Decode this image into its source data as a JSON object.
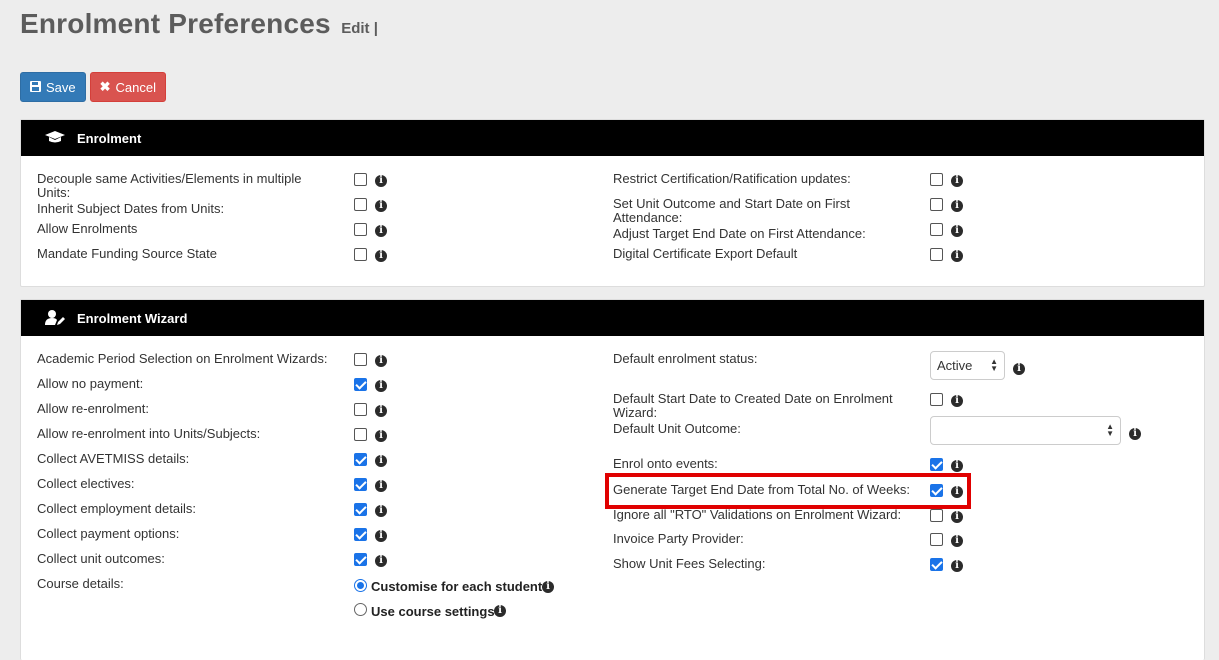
{
  "header": {
    "title": "Enrolment Preferences",
    "subtitle": "Edit |"
  },
  "toolbar": {
    "save_label": "Save",
    "cancel_label": "Cancel",
    "save_icon": "floppy-icon",
    "cancel_icon": "x-icon"
  },
  "enrolment": {
    "title": "Enrolment",
    "icon": "graduation-cap-icon",
    "left": [
      {
        "label_line1": "Decouple same Activities/Elements in multiple",
        "label_line2": "Units:",
        "checked": false
      },
      {
        "label_line1": "Inherit Subject Dates from Units:",
        "checked": false
      },
      {
        "label_line1": "Allow Enrolments",
        "checked": false
      },
      {
        "label_line1": "Mandate Funding Source State",
        "checked": false
      }
    ],
    "right": [
      {
        "label_line1": "Restrict Certification/Ratification updates:",
        "checked": false
      },
      {
        "label_line1": "Set Unit Outcome and Start Date on First",
        "label_line2": "Attendance:",
        "checked": false
      },
      {
        "label_line1": "Adjust Target End Date on First Attendance:",
        "checked": false
      },
      {
        "label_line1": "Digital Certificate Export Default",
        "checked": false
      }
    ]
  },
  "wizard": {
    "title": "Enrolment Wizard",
    "icon": "user-edit-icon",
    "left": [
      {
        "label": "Academic Period Selection on Enrolment Wizards:",
        "checked": false
      },
      {
        "label": "Allow no payment:",
        "checked": true
      },
      {
        "label": "Allow re-enrolment:",
        "checked": false
      },
      {
        "label": "Allow re-enrolment into Units/Subjects:",
        "checked": false
      },
      {
        "label": "Collect AVETMISS details:",
        "checked": true
      },
      {
        "label": "Collect electives:",
        "checked": true
      },
      {
        "label": "Collect employment details:",
        "checked": true
      },
      {
        "label": "Collect payment options:",
        "checked": true
      },
      {
        "label": "Collect unit outcomes:",
        "checked": true
      }
    ],
    "course_details": {
      "label": "Course details:",
      "options": [
        {
          "label": "Customise for each student",
          "selected": true
        },
        {
          "label": "Use course settings",
          "selected": false
        }
      ]
    },
    "right": {
      "default_status": {
        "label": "Default enrolment status:",
        "value": "Active"
      },
      "default_start_date": {
        "label_line1": "Default Start Date to Created Date on Enrolment",
        "label_line2": "Wizard:",
        "checked": false
      },
      "default_unit_outcome": {
        "label": "Default Unit Outcome:",
        "value": ""
      },
      "enrol_events": {
        "label": "Enrol onto events:",
        "checked": true
      },
      "generate_target": {
        "label": "Generate Target End Date from Total No. of Weeks:",
        "checked": true
      },
      "ignore_rto": {
        "label": "Ignore all \"RTO\" Validations on Enrolment Wizard:",
        "checked": false
      },
      "invoice_party": {
        "label": "Invoice Party Provider:",
        "checked": false
      },
      "show_unit_fees": {
        "label": "Show Unit Fees Selecting:",
        "checked": true
      }
    }
  },
  "colors": {
    "save": "#337ab7",
    "cancel": "#d9534f",
    "checkbox_checked": "#1a73e8",
    "highlight": "#e00000",
    "panel_header": "#000000"
  }
}
